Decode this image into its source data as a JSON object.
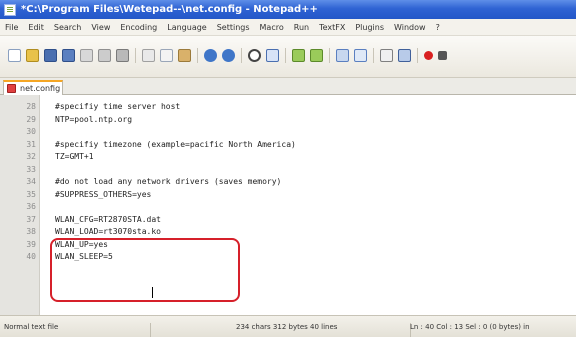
{
  "window": {
    "title": "*C:\\Program Files\\Wetepad--\\net.config - Notepad++"
  },
  "menu": {
    "items": [
      "File",
      "Edit",
      "Search",
      "View",
      "Encoding",
      "Language",
      "Settings",
      "Macro",
      "Run",
      "TextFX",
      "Plugins",
      "Window",
      "?"
    ]
  },
  "toolbar": {
    "icons": [
      "new-file",
      "open-folder",
      "save",
      "save-all",
      "close",
      "close-all",
      "print",
      "cut",
      "copy",
      "paste",
      "undo",
      "redo",
      "find",
      "replace",
      "zoom-in",
      "zoom-out",
      "word-wrap",
      "indent-guide",
      "show-all-characters",
      "macro",
      "record",
      "stop"
    ]
  },
  "tab": {
    "label": "net.config"
  },
  "editor": {
    "lines": [
      {
        "num": "28",
        "text": "#specifiy time server host"
      },
      {
        "num": "29",
        "text": "NTP=pool.ntp.org"
      },
      {
        "num": "30",
        "text": ""
      },
      {
        "num": "31",
        "text": "#specifiy timezone (example=pacific North America)"
      },
      {
        "num": "32",
        "text": "TZ=GMT+1"
      },
      {
        "num": "33",
        "text": ""
      },
      {
        "num": "34",
        "text": "#do not load any network drivers (saves memory)"
      },
      {
        "num": "35",
        "text": "#SUPPRESS_OTHERS=yes"
      },
      {
        "num": "36",
        "text": ""
      },
      {
        "num": "37",
        "text": "WLAN_CFG=RT2870STA.dat"
      },
      {
        "num": "38",
        "text": "WLAN_LOAD=rt3070sta.ko"
      },
      {
        "num": "39",
        "text": "WLAN_UP=yes"
      },
      {
        "num": "40",
        "text": "WLAN_SLEEP=5"
      }
    ],
    "highlight_color": "#d6202a"
  },
  "status": {
    "file_type": "Normal text file",
    "length": "234 chars   312 bytes   40 lines",
    "position": "Ln : 40    Col : 13    Sel : 0 (0 bytes) in"
  }
}
